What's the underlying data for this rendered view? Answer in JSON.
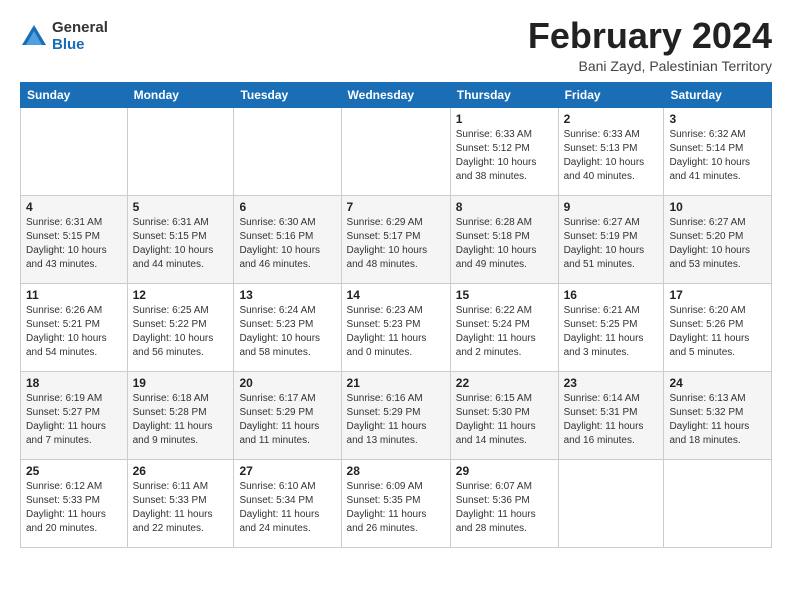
{
  "logo": {
    "general": "General",
    "blue": "Blue"
  },
  "title": "February 2024",
  "location": "Bani Zayd, Palestinian Territory",
  "days_of_week": [
    "Sunday",
    "Monday",
    "Tuesday",
    "Wednesday",
    "Thursday",
    "Friday",
    "Saturday"
  ],
  "weeks": [
    [
      {
        "day": "",
        "info": ""
      },
      {
        "day": "",
        "info": ""
      },
      {
        "day": "",
        "info": ""
      },
      {
        "day": "",
        "info": ""
      },
      {
        "day": "1",
        "info": "Sunrise: 6:33 AM\nSunset: 5:12 PM\nDaylight: 10 hours\nand 38 minutes."
      },
      {
        "day": "2",
        "info": "Sunrise: 6:33 AM\nSunset: 5:13 PM\nDaylight: 10 hours\nand 40 minutes."
      },
      {
        "day": "3",
        "info": "Sunrise: 6:32 AM\nSunset: 5:14 PM\nDaylight: 10 hours\nand 41 minutes."
      }
    ],
    [
      {
        "day": "4",
        "info": "Sunrise: 6:31 AM\nSunset: 5:15 PM\nDaylight: 10 hours\nand 43 minutes."
      },
      {
        "day": "5",
        "info": "Sunrise: 6:31 AM\nSunset: 5:15 PM\nDaylight: 10 hours\nand 44 minutes."
      },
      {
        "day": "6",
        "info": "Sunrise: 6:30 AM\nSunset: 5:16 PM\nDaylight: 10 hours\nand 46 minutes."
      },
      {
        "day": "7",
        "info": "Sunrise: 6:29 AM\nSunset: 5:17 PM\nDaylight: 10 hours\nand 48 minutes."
      },
      {
        "day": "8",
        "info": "Sunrise: 6:28 AM\nSunset: 5:18 PM\nDaylight: 10 hours\nand 49 minutes."
      },
      {
        "day": "9",
        "info": "Sunrise: 6:27 AM\nSunset: 5:19 PM\nDaylight: 10 hours\nand 51 minutes."
      },
      {
        "day": "10",
        "info": "Sunrise: 6:27 AM\nSunset: 5:20 PM\nDaylight: 10 hours\nand 53 minutes."
      }
    ],
    [
      {
        "day": "11",
        "info": "Sunrise: 6:26 AM\nSunset: 5:21 PM\nDaylight: 10 hours\nand 54 minutes."
      },
      {
        "day": "12",
        "info": "Sunrise: 6:25 AM\nSunset: 5:22 PM\nDaylight: 10 hours\nand 56 minutes."
      },
      {
        "day": "13",
        "info": "Sunrise: 6:24 AM\nSunset: 5:23 PM\nDaylight: 10 hours\nand 58 minutes."
      },
      {
        "day": "14",
        "info": "Sunrise: 6:23 AM\nSunset: 5:23 PM\nDaylight: 11 hours\nand 0 minutes."
      },
      {
        "day": "15",
        "info": "Sunrise: 6:22 AM\nSunset: 5:24 PM\nDaylight: 11 hours\nand 2 minutes."
      },
      {
        "day": "16",
        "info": "Sunrise: 6:21 AM\nSunset: 5:25 PM\nDaylight: 11 hours\nand 3 minutes."
      },
      {
        "day": "17",
        "info": "Sunrise: 6:20 AM\nSunset: 5:26 PM\nDaylight: 11 hours\nand 5 minutes."
      }
    ],
    [
      {
        "day": "18",
        "info": "Sunrise: 6:19 AM\nSunset: 5:27 PM\nDaylight: 11 hours\nand 7 minutes."
      },
      {
        "day": "19",
        "info": "Sunrise: 6:18 AM\nSunset: 5:28 PM\nDaylight: 11 hours\nand 9 minutes."
      },
      {
        "day": "20",
        "info": "Sunrise: 6:17 AM\nSunset: 5:29 PM\nDaylight: 11 hours\nand 11 minutes."
      },
      {
        "day": "21",
        "info": "Sunrise: 6:16 AM\nSunset: 5:29 PM\nDaylight: 11 hours\nand 13 minutes."
      },
      {
        "day": "22",
        "info": "Sunrise: 6:15 AM\nSunset: 5:30 PM\nDaylight: 11 hours\nand 14 minutes."
      },
      {
        "day": "23",
        "info": "Sunrise: 6:14 AM\nSunset: 5:31 PM\nDaylight: 11 hours\nand 16 minutes."
      },
      {
        "day": "24",
        "info": "Sunrise: 6:13 AM\nSunset: 5:32 PM\nDaylight: 11 hours\nand 18 minutes."
      }
    ],
    [
      {
        "day": "25",
        "info": "Sunrise: 6:12 AM\nSunset: 5:33 PM\nDaylight: 11 hours\nand 20 minutes."
      },
      {
        "day": "26",
        "info": "Sunrise: 6:11 AM\nSunset: 5:33 PM\nDaylight: 11 hours\nand 22 minutes."
      },
      {
        "day": "27",
        "info": "Sunrise: 6:10 AM\nSunset: 5:34 PM\nDaylight: 11 hours\nand 24 minutes."
      },
      {
        "day": "28",
        "info": "Sunrise: 6:09 AM\nSunset: 5:35 PM\nDaylight: 11 hours\nand 26 minutes."
      },
      {
        "day": "29",
        "info": "Sunrise: 6:07 AM\nSunset: 5:36 PM\nDaylight: 11 hours\nand 28 minutes."
      },
      {
        "day": "",
        "info": ""
      },
      {
        "day": "",
        "info": ""
      }
    ]
  ]
}
